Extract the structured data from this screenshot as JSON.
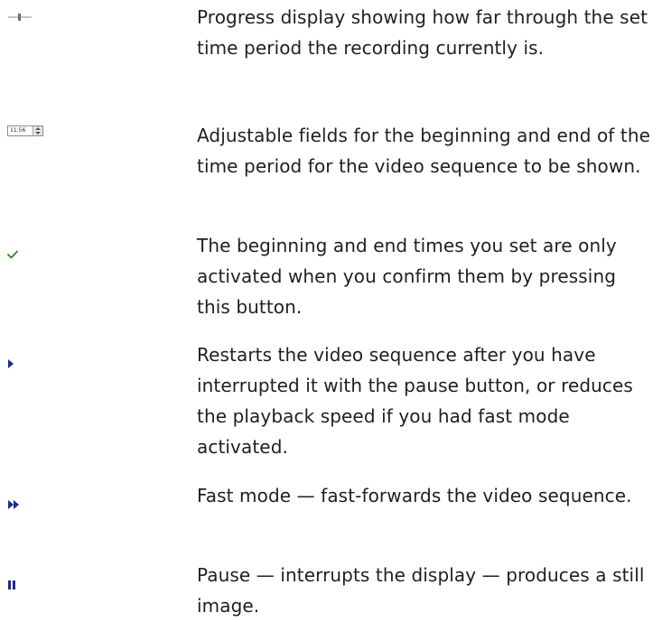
{
  "rows": [
    {
      "icon": "progress-slider-icon",
      "text": "Progress display showing how far through the set time period the recording currently is."
    },
    {
      "icon": "time-spinner-icon",
      "field_value": "11:56",
      "text": "Adjustable fields for the beginning and end of the time period for the video sequence to be shown."
    },
    {
      "icon": "checkmark-icon",
      "text": "The beginning and end times you set are only activated when you confirm them by pressing this button."
    },
    {
      "icon": "play-icon",
      "text": "Restarts the video sequence after you have interrupted it with the pause button, or reduces the playback speed if you had fast mode activated."
    },
    {
      "icon": "fast-forward-icon",
      "text": "Fast mode — fast-forwards the video sequence."
    },
    {
      "icon": "pause-icon",
      "text": "Pause — interrupts the display — produces a still image."
    }
  ],
  "colors": {
    "text": "#1f1f1f",
    "check": "#2e8b1e",
    "play": "#1a2d8c"
  }
}
